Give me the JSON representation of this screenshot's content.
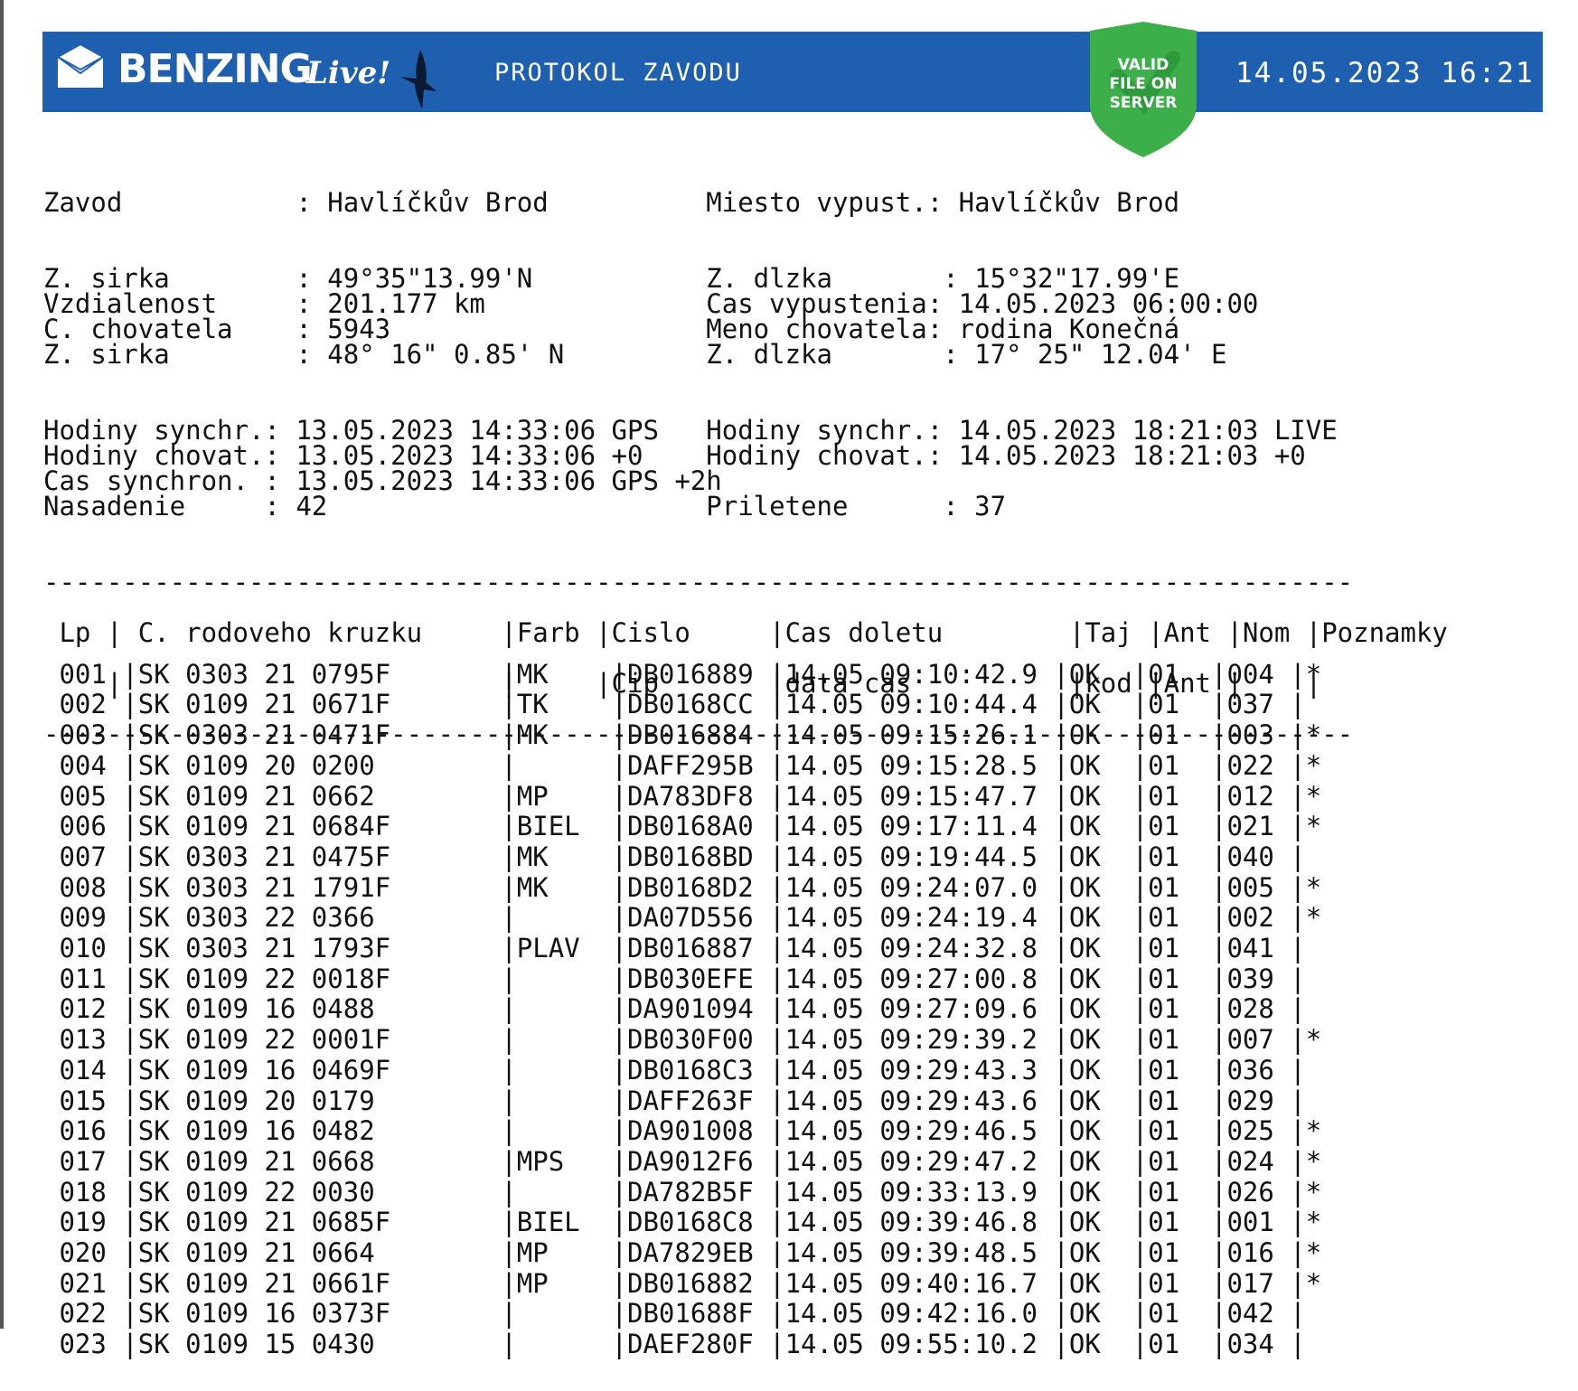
{
  "header": {
    "brand": "BENZING",
    "brand_suffix": "Live!",
    "title": "PROTOKOL ZAVODU",
    "badge_lines": [
      "VALID",
      "FILE ON",
      "SERVER"
    ],
    "datetime": "14.05.2023 16:21",
    "colors": {
      "banner": "#1f5fb0",
      "badge": "#3cae4a",
      "text": "#ffffff"
    },
    "icons": [
      "envelope-logo-icon",
      "bird-icon",
      "shield-badge-icon"
    ]
  },
  "info_lines": [
    "Zavod           : Havlíčkův Brod          Miesto vypust.: Havlíčkův Brod",
    "",
    "",
    "Z. sirka        : 49°35\"13.99'N           Z. dlzka       : 15°32\"17.99'E",
    "Vzdialenost     : 201.177 km              Cas vypustenia: 14.05.2023 06:00:00",
    "C. chovatela    : 5943                    Meno chovatela: rodina Konečná",
    "Z. sirka        : 48° 16\" 0.85' N         Z. dlzka       : 17° 25\" 12.04' E",
    "",
    "",
    "Hodiny synchr.: 13.05.2023 14:33:06 GPS   Hodiny synchr.: 14.05.2023 18:21:03 LIVE",
    "Hodiny chovat.: 13.05.2023 14:33:06 +0    Hodiny chovat.: 14.05.2023 18:21:03 +0",
    "Cas synchron. : 13.05.2023 14:33:06 GPS +2h",
    "Nasadenie     : 42                        Priletene      : 37",
    "",
    "",
    "-----------------------------------------------------------------------------------",
    "",
    " Lp | C. rodoveho kruzku     |Farb |Cislo     |Cas doletu        |Taj |Ant |Nom |Poznamky",
    "",
    "    |                        |     |Cip       |data cas          |kod |Ant |    |",
    "",
    "-----------------------------------------------------------------------------------"
  ],
  "rows": [
    " 001 |SK 0303 21 0795F       |MK    |DB016889 |14.05 09:10:42.9 |OK  |01  |004 |*",
    " 002 |SK 0109 21 0671F       |TK    |DB0168CC |14.05 09:10:44.4 |OK  |01  |037 |",
    " 003 |SK 0303 21 0471F       |MK    |DB016884 |14.05 09:15:26.1 |OK  |01  |003 |*",
    " 004 |SK 0109 20 0200        |      |DAFF295B |14.05 09:15:28.5 |OK  |01  |022 |*",
    " 005 |SK 0109 21 0662        |MP    |DA783DF8 |14.05 09:15:47.7 |OK  |01  |012 |*",
    " 006 |SK 0109 21 0684F       |BIEL  |DB0168A0 |14.05 09:17:11.4 |OK  |01  |021 |*",
    " 007 |SK 0303 21 0475F       |MK    |DB0168BD |14.05 09:19:44.5 |OK  |01  |040 |",
    " 008 |SK 0303 21 1791F       |MK    |DB0168D2 |14.05 09:24:07.0 |OK  |01  |005 |*",
    " 009 |SK 0303 22 0366        |      |DA07D556 |14.05 09:24:19.4 |OK  |01  |002 |*",
    " 010 |SK 0303 21 1793F       |PLAV  |DB016887 |14.05 09:24:32.8 |OK  |01  |041 |",
    " 011 |SK 0109 22 0018F       |      |DB030EFE |14.05 09:27:00.8 |OK  |01  |039 |",
    " 012 |SK 0109 16 0488        |      |DA901094 |14.05 09:27:09.6 |OK  |01  |028 |",
    " 013 |SK 0109 22 0001F       |      |DB030F00 |14.05 09:29:39.2 |OK  |01  |007 |*",
    " 014 |SK 0109 16 0469F       |      |DB0168C3 |14.05 09:29:43.3 |OK  |01  |036 |",
    " 015 |SK 0109 20 0179        |      |DAFF263F |14.05 09:29:43.6 |OK  |01  |029 |",
    " 016 |SK 0109 16 0482        |      |DA901008 |14.05 09:29:46.5 |OK  |01  |025 |*",
    " 017 |SK 0109 21 0668        |MPS   |DA9012F6 |14.05 09:29:47.2 |OK  |01  |024 |*",
    " 018 |SK 0109 22 0030        |      |DA782B5F |14.05 09:33:13.9 |OK  |01  |026 |*",
    " 019 |SK 0109 21 0685F       |BIEL  |DB0168C8 |14.05 09:39:46.8 |OK  |01  |001 |*",
    " 020 |SK 0109 21 0664        |MP    |DA7829EB |14.05 09:39:48.5 |OK  |01  |016 |*",
    " 021 |SK 0109 21 0661F       |MP    |DB016882 |14.05 09:40:16.7 |OK  |01  |017 |*",
    " 022 |SK 0109 16 0373F       |      |DB01688F |14.05 09:42:16.0 |OK  |01  |042 |",
    " 023 |SK 0109 15 0430        |      |DAEF280F |14.05 09:55:10.2 |OK  |01  |034 |"
  ]
}
